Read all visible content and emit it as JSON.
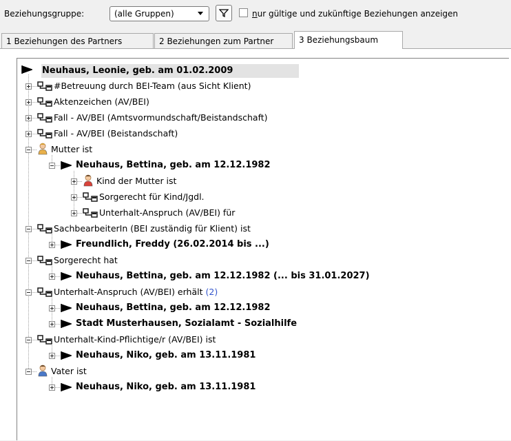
{
  "toolbar": {
    "group_label": "Beziehungsgruppe:",
    "group_value": "(alle Gruppen)",
    "only_valid_label": "nur gültige und zukünftige Beziehungen anzeigen",
    "only_valid_checked": false
  },
  "tabs": [
    {
      "label": "1 Beziehungen des Partners",
      "active": false
    },
    {
      "label": "2 Beziehungen zum Partner",
      "active": false
    },
    {
      "label": "3 Beziehungsbaum",
      "active": true
    }
  ],
  "tree": {
    "root": "Neuhaus, Leonie, geb. am 01.02.2009",
    "nodes": [
      {
        "text": "#Betreuung durch BEI-Team (aus Sicht Klient)",
        "count": ""
      },
      {
        "text": "Aktenzeichen (AV/BEI)",
        "count": ""
      },
      {
        "text": "Fall - AV/BEI (Amtsvormundschaft/Beistandschaft)",
        "count": ""
      },
      {
        "text": "Fall - AV/BEI (Beistandschaft)",
        "count": ""
      },
      {
        "text": "Mutter ist",
        "count": ""
      },
      {
        "text": "Neuhaus, Bettina, geb. am 12.12.1982",
        "count": ""
      },
      {
        "text": "Kind der Mutter ist",
        "count": ""
      },
      {
        "text": "Sorgerecht für Kind/Jgdl.",
        "count": ""
      },
      {
        "text": "Unterhalt-Anspruch (AV/BEI) für",
        "count": ""
      },
      {
        "text": "SachbearbeiterIn (BEI zuständig für Klient) ist",
        "count": ""
      },
      {
        "text": "Freundlich, Freddy (26.02.2014 bis ...)",
        "count": ""
      },
      {
        "text": "Sorgerecht hat",
        "count": ""
      },
      {
        "text": "Neuhaus, Bettina, geb. am 12.12.1982 (... bis 31.01.2027)",
        "count": ""
      },
      {
        "text": "Unterhalt-Anspruch (AV/BEI) erhält",
        "count": "(2)"
      },
      {
        "text": "Neuhaus, Bettina, geb. am 12.12.1982",
        "count": ""
      },
      {
        "text": "Stadt Musterhausen, Sozialamt - Sozialhilfe",
        "count": ""
      },
      {
        "text": "Unterhalt-Kind-Pflichtige/r (AV/BEI) ist",
        "count": ""
      },
      {
        "text": "Neuhaus, Niko, geb. am 13.11.1981",
        "count": ""
      },
      {
        "text": "Vater ist",
        "count": ""
      },
      {
        "text": "Neuhaus, Niko, geb. am 13.11.1981",
        "count": ""
      }
    ]
  },
  "colors": {
    "count": "#3355cc",
    "relation_icon": "#1a1a1a",
    "mother_icon": "#e8b04a",
    "child_icon": "#d9433a",
    "father_icon": "#4a78c8"
  }
}
